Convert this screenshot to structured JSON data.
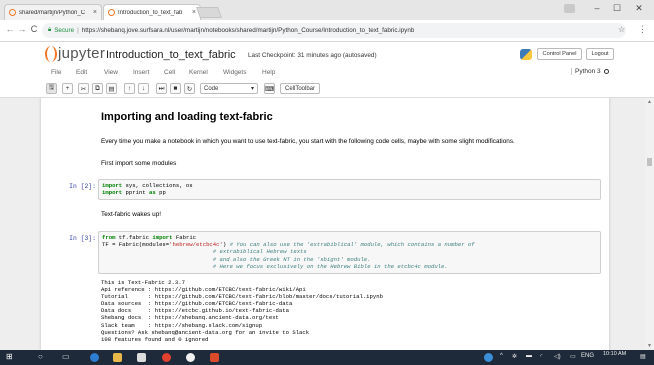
{
  "browser": {
    "tabs": [
      {
        "title": "shared/martijn/Python_C",
        "active": false
      },
      {
        "title": "Introduction_to_text_fab",
        "active": true
      }
    ],
    "url_secure_label": "Secure",
    "url": "https://shebanq.jove.surfsara.nl/user/martijn/notebooks/shared/martijn/Python_Course/Introduction_to_text_fabric.ipynb"
  },
  "jupyter": {
    "logo_text": "jupyter",
    "notebook_name": "Introduction_to_text_fabric",
    "checkpoint": "Last Checkpoint: 31 minutes ago (autosaved)",
    "control_panel_label": "Control Panel",
    "logout_label": "Logout",
    "kernel_label": "Python 3",
    "menu": [
      "File",
      "Edit",
      "View",
      "Insert",
      "Cell",
      "Kernel",
      "Widgets",
      "Help"
    ],
    "celltype_selected": "Code",
    "celltoolbar_label": "CellToolbar"
  },
  "notebook": {
    "heading": "Importing and loading text-fabric",
    "para1": "Every time you make a notebook in which you want to use text-fabric, you start with the following code cells, maybe with some slight modifications.",
    "para2": "First import some modules",
    "cell2_prompt": "In [2]:",
    "para3": "Text-fabric wakes up!",
    "cell3_prompt": "In [3]:",
    "output": [
      "This is Text-Fabric 2.3.7",
      "Api reference : https://github.com/ETCBC/text-fabric/wiki/Api",
      "Tutorial      : https://github.com/ETCBC/text-fabric/blob/master/docs/tutorial.ipynb",
      "Data sources  : https://github.com/ETCBC/text-fabric-data",
      "Data docs     : https://etcbc.github.io/text-fabric-data",
      "Shebang docs  : https://shebanq.ancient-data.org/text",
      "Slack team    : https://shebang.slack.com/signup",
      "Questions? Ask shebanq@ancient-data.org for an invite to Slack",
      "108 features found and 0 ignored"
    ]
  },
  "taskbar": {
    "lang": "ENG",
    "time": "10:10 AM"
  }
}
